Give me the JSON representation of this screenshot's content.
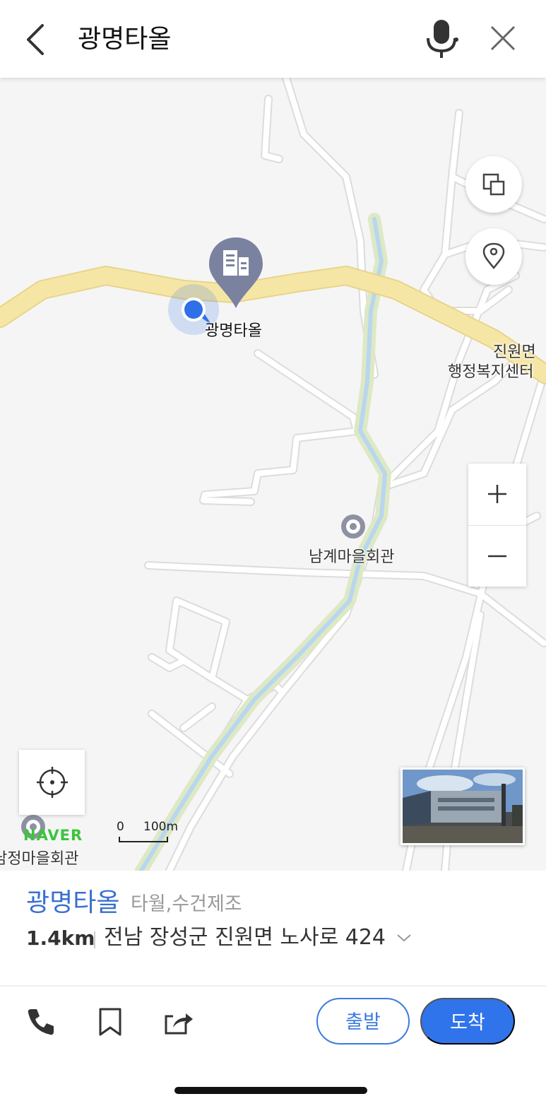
{
  "header": {
    "search_text": "광명타올",
    "back_icon": "chevron-left-icon",
    "mic_icon": "microphone-icon",
    "close_icon": "close-icon"
  },
  "map": {
    "pin_icon": "building-icon",
    "pin_label": "광명타올",
    "poi_1": "남계마을회관",
    "poi_2_line1": "진원면",
    "poi_2_line2": "행정복지센터",
    "poi_3": "남정마을회관",
    "layers_icon": "layers-icon",
    "location_pin_icon": "location-pin-icon",
    "zoom_in_icon": "plus-icon",
    "zoom_out_icon": "minus-icon",
    "locate_icon": "crosshair-icon",
    "logo": "NAVER",
    "scale_zero": "0",
    "scale_length": "100m",
    "colors": {
      "main_road": "#f6e6a6",
      "stream": "#b9d6ef",
      "pin": "#7a82a0",
      "my_location": "#2f6fe8"
    }
  },
  "place": {
    "name": "광명타올",
    "category": "타월,수건제조",
    "distance": "1.4km",
    "address": "전남 장성군 진원면 노사로 424"
  },
  "actions": {
    "phone_icon": "phone-icon",
    "bookmark_icon": "bookmark-icon",
    "share_icon": "share-icon",
    "depart_label": "출발",
    "arrive_label": "도착"
  }
}
